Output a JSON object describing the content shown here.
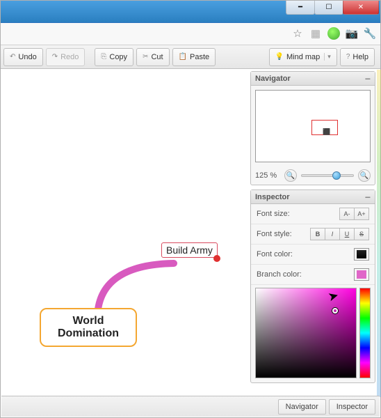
{
  "toolbar": {
    "undo": "Undo",
    "redo": "Redo",
    "copy": "Copy",
    "cut": "Cut",
    "paste": "Paste",
    "mindmap": "Mind map",
    "help": "Help"
  },
  "mindmap": {
    "root_label": "World Domination",
    "child_label": "Build Army"
  },
  "navigator": {
    "title": "Navigator",
    "zoom": "125 %"
  },
  "inspector": {
    "title": "Inspector",
    "font_size_label": "Font size:",
    "font_size_dec": "A-",
    "font_size_inc": "A+",
    "font_style_label": "Font style:",
    "style_b": "B",
    "style_i": "I",
    "style_u": "U",
    "style_s": "S",
    "font_color_label": "Font color:",
    "branch_color_label": "Branch color:",
    "font_color": "#000000",
    "branch_color": "#e066c8"
  },
  "statusbar": {
    "navigator": "Navigator",
    "inspector": "Inspector"
  }
}
